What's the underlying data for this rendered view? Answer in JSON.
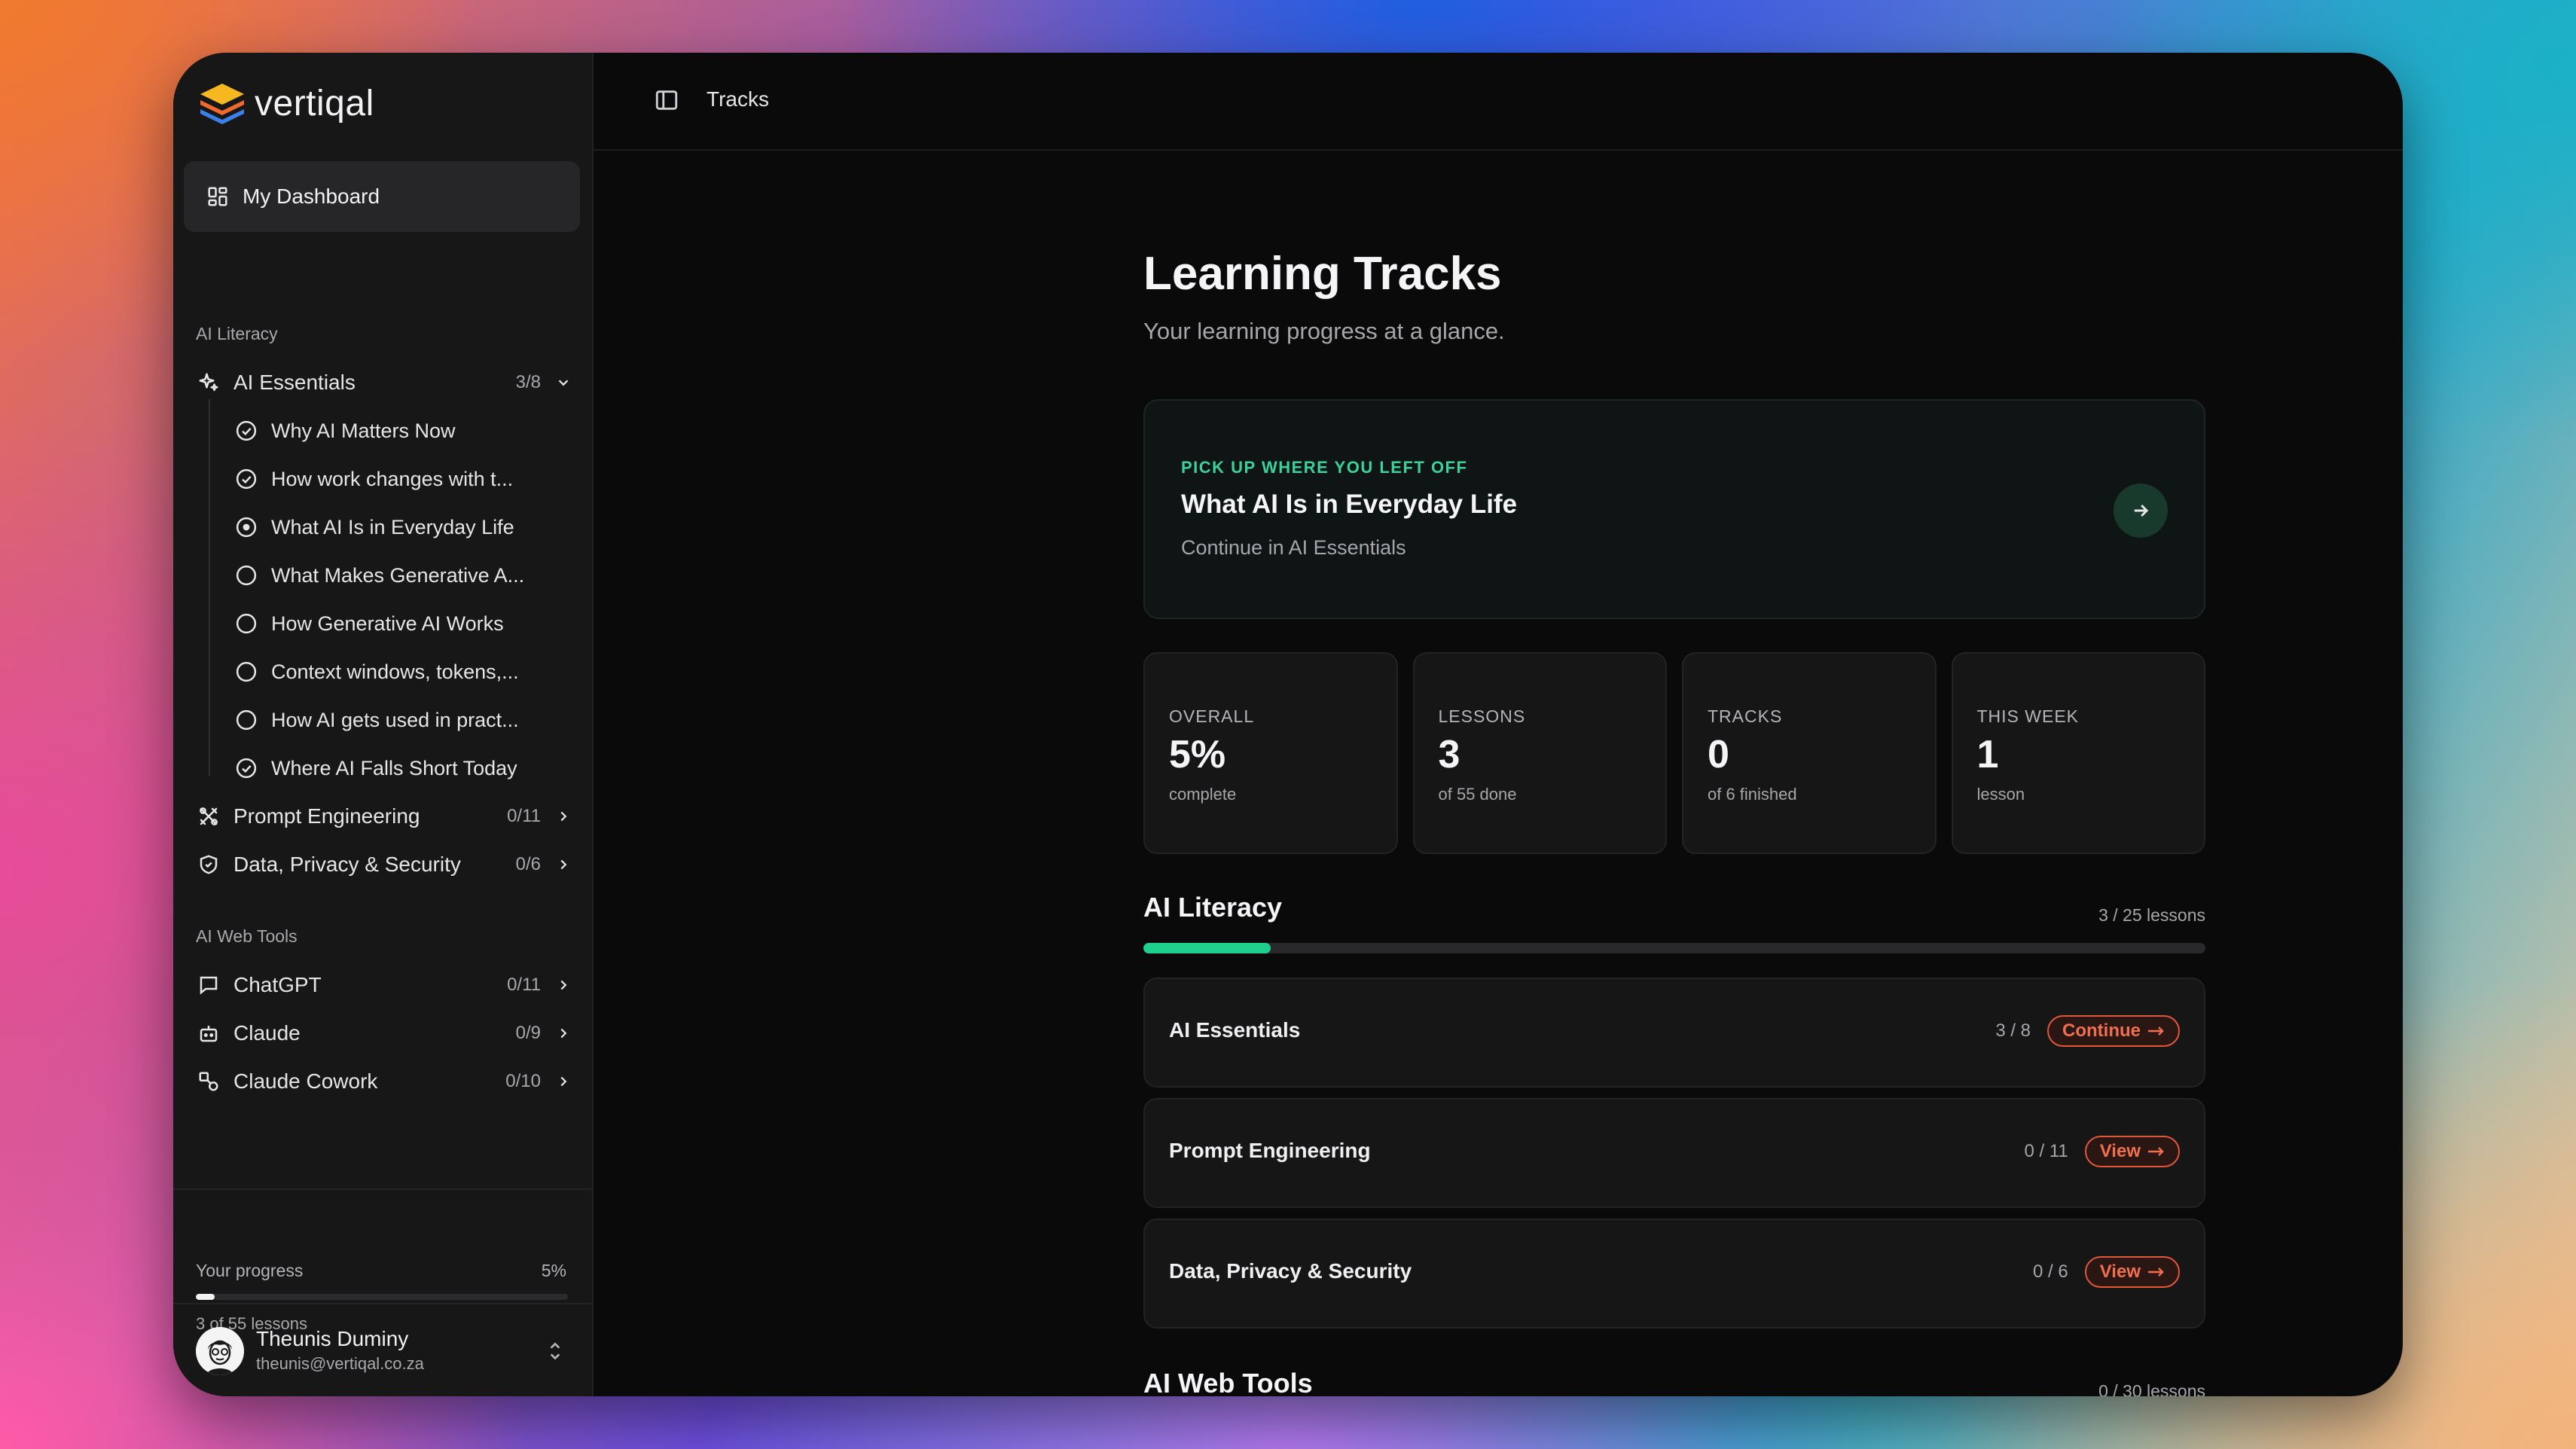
{
  "brand": {
    "name": "vertiqal"
  },
  "topbar": {
    "title": "Tracks"
  },
  "sidebar": {
    "dashboard_label": "My Dashboard",
    "groups": [
      {
        "label": "AI Literacy",
        "items": [
          {
            "label": "AI Essentials",
            "count": "3/8",
            "icon": "sparkles-icon",
            "expanded": true,
            "lessons": [
              {
                "label": "Why AI Matters Now",
                "status": "done"
              },
              {
                "label": "How work changes with t...",
                "status": "done"
              },
              {
                "label": "What AI Is in Everyday Life",
                "status": "current"
              },
              {
                "label": "What Makes Generative A...",
                "status": "todo"
              },
              {
                "label": "How Generative AI Works",
                "status": "todo"
              },
              {
                "label": "Context windows, tokens,...",
                "status": "todo"
              },
              {
                "label": "How AI gets used in pract...",
                "status": "todo"
              },
              {
                "label": "Where AI Falls Short Today",
                "status": "done"
              }
            ]
          },
          {
            "label": "Prompt Engineering",
            "count": "0/11",
            "icon": "tools-icon"
          },
          {
            "label": "Data, Privacy & Security",
            "count": "0/6",
            "icon": "shield-icon"
          }
        ]
      },
      {
        "label": "AI Web Tools",
        "items": [
          {
            "label": "ChatGPT",
            "count": "0/11",
            "icon": "chat-icon"
          },
          {
            "label": "Claude",
            "count": "0/9",
            "icon": "bot-icon"
          },
          {
            "label": "Claude Cowork",
            "count": "0/10",
            "icon": "shapes-icon"
          }
        ]
      }
    ],
    "progress": {
      "label": "Your progress",
      "percent_text": "5%",
      "fraction": 0.05,
      "sub": "3 of 55 lessons"
    },
    "user": {
      "name": "Theunis Duminy",
      "email": "theunis@vertiqal.co.za"
    }
  },
  "main": {
    "title": "Learning Tracks",
    "subtitle": "Your learning progress at a glance.",
    "resume": {
      "kicker": "PICK UP WHERE YOU LEFT OFF",
      "title": "What AI Is in Everyday Life",
      "sub": "Continue in AI Essentials"
    },
    "stats": [
      {
        "label": "OVERALL",
        "value": "5%",
        "sub": "complete"
      },
      {
        "label": "LESSONS",
        "value": "3",
        "sub": "of 55 done"
      },
      {
        "label": "TRACKS",
        "value": "0",
        "sub": "of 6 finished"
      },
      {
        "label": "THIS WEEK",
        "value": "1",
        "sub": "lesson"
      }
    ],
    "sections": [
      {
        "title": "AI Literacy",
        "count": "3 / 25 lessons",
        "fraction": 0.12,
        "tracks": [
          {
            "name": "AI Essentials",
            "count": "3 / 8",
            "action": "Continue"
          },
          {
            "name": "Prompt Engineering",
            "count": "0 / 11",
            "action": "View"
          },
          {
            "name": "Data, Privacy & Security",
            "count": "0 / 6",
            "action": "View"
          }
        ]
      },
      {
        "title": "AI Web Tools",
        "count": "0 / 30 lessons",
        "fraction": 0,
        "tracks": []
      }
    ]
  },
  "colors": {
    "accent_green": "#1fcf8e",
    "action_orange": "#f0704e",
    "window_bg": "#0a0a0b",
    "sidebar_bg": "#171718"
  }
}
